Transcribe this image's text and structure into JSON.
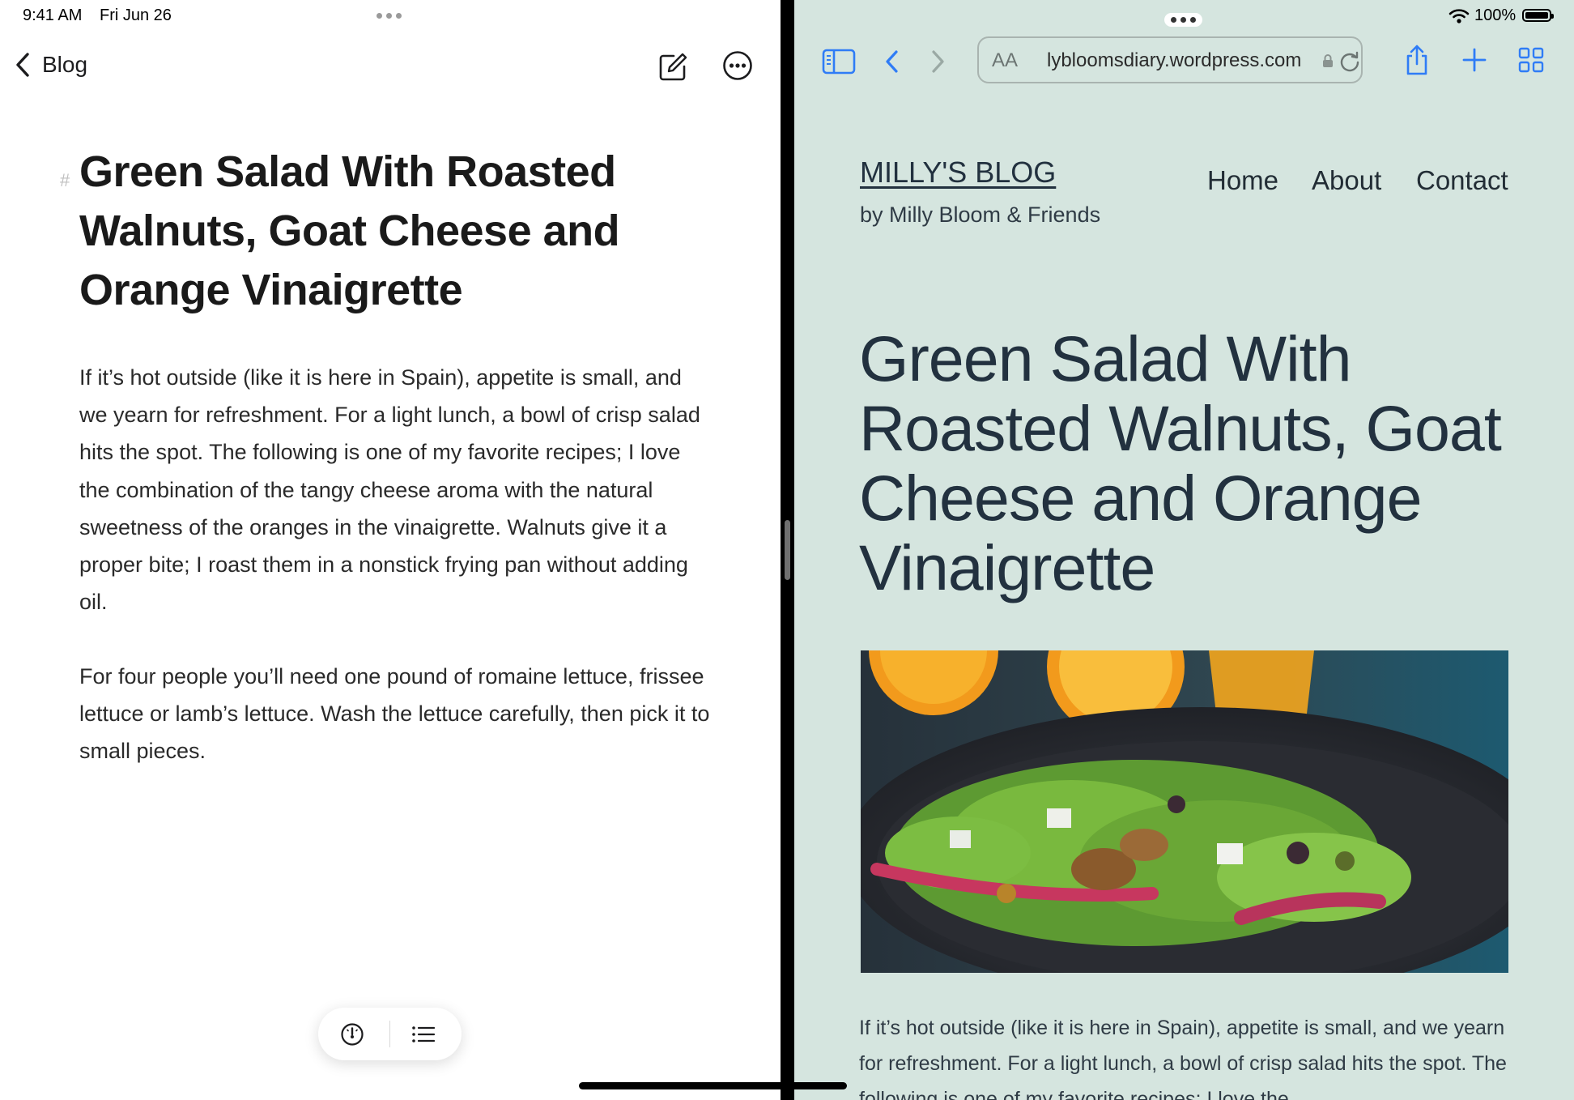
{
  "status": {
    "time": "9:41 AM",
    "date": "Fri Jun 26",
    "battery": "100%"
  },
  "editor": {
    "back_label": "Blog",
    "heading_marker": "#",
    "title": "Green Salad With Roasted Walnuts, Goat Cheese and Orange Vinaigrette",
    "paragraphs": [
      "If it’s hot outside (like it is here in Spain), appetite is small, and we yearn for refreshment. For a light lunch, a bowl of crisp salad hits the spot. The following is one of my favorite recipes; I love the combination of the tangy cheese aroma with the natural sweetness of the oranges in the vinaigrette. Walnuts give it a proper bite; I roast them in a nonstick frying pan without adding oil.",
      "For four people you’ll need one pound of romaine lettuce, frissee lettuce or lamb’s lettuce. Wash the lettuce carefully, then pick it to small pieces."
    ]
  },
  "browser": {
    "reader_label": "AA",
    "url": "lybloomsdiary.wordpress.com",
    "accent": "#2f7cf6",
    "background": "#d5e5df"
  },
  "site": {
    "name": "MILLY'S BLOG",
    "tagline": "by Milly Bloom & Friends",
    "nav": [
      "Home",
      "About",
      "Contact"
    ],
    "post_title": "Green Salad With Roasted Walnuts, Goat Cheese and Orange Vinaigrette",
    "post_excerpt": "If it’s hot outside (like it is here in Spain), appetite is small, and we yearn for refreshment. For a light lunch, a bowl of crisp salad hits the spot. The following is one of my favorite recipes; I love the"
  }
}
